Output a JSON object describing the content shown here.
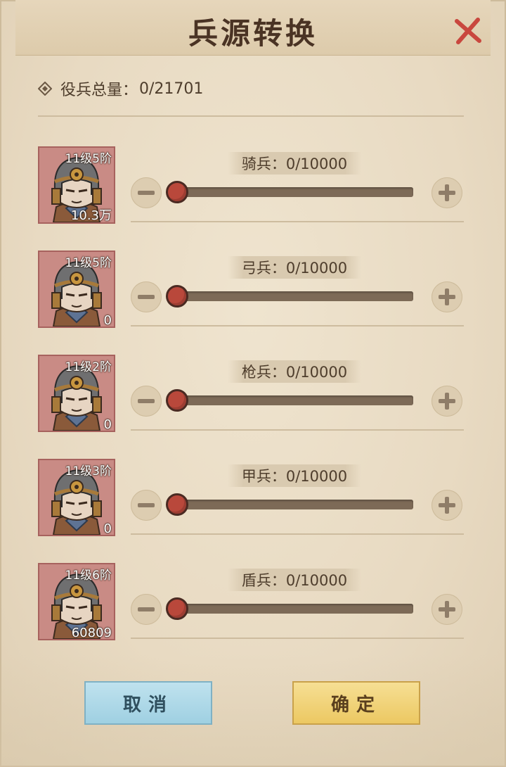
{
  "dialog": {
    "title": "兵源转换",
    "total_label": "役兵总量：",
    "total_value": "0/21701",
    "cancel_label": "取消",
    "confirm_label": "确定"
  },
  "units": [
    {
      "level": "11级5阶",
      "count": "10.3万",
      "value_text": "骑兵：0/10000",
      "fraction": 0
    },
    {
      "level": "11级5阶",
      "count": "0",
      "value_text": "弓兵：0/10000",
      "fraction": 0
    },
    {
      "level": "11级2阶",
      "count": "0",
      "value_text": "枪兵：0/10000",
      "fraction": 0
    },
    {
      "level": "11级3阶",
      "count": "0",
      "value_text": "甲兵：0/10000",
      "fraction": 0
    },
    {
      "level": "11级6阶",
      "count": "60809",
      "value_text": "盾兵：0/10000",
      "fraction": 0
    }
  ],
  "icons": {
    "close": "close-icon",
    "total": "diamond-icon",
    "minus": "minus-icon",
    "plus": "plus-icon",
    "portrait": "soldier-helmet-icon"
  },
  "colors": {
    "accent_red": "#b9483b",
    "close_red": "#c9473e",
    "cancel_blue": "#9fd0e2",
    "confirm_gold": "#ecc862"
  }
}
